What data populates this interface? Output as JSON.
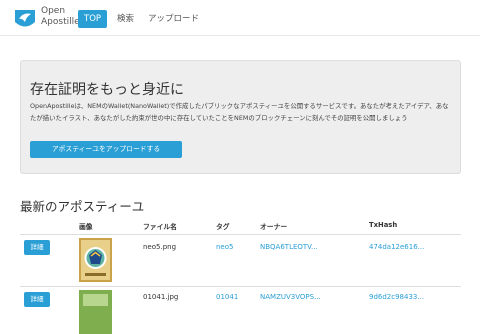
{
  "nav": {
    "brand_line1": "Open",
    "brand_line2": "Apostille",
    "items": [
      {
        "label": "TOP",
        "active": true
      },
      {
        "label": "検索",
        "active": false
      },
      {
        "label": "アップロード",
        "active": false
      }
    ]
  },
  "jumbotron": {
    "title": "存在証明をもっと身近に",
    "text": "OpenApostilleは、NEMのWallet(NanoWallet)で作成したパブリックなアポスティーユを公開するサービスです。あなたが考えたアイデア、あなたが描いたイラスト、あなたがした約束が世の中に存在していたことをNEMのブロックチェーンに刻んでその証明を公開しましょう",
    "upload_label": "アポスティーユをアップロードする"
  },
  "latest": {
    "title": "最新のアポスティーユ",
    "headers": [
      "画像",
      "ファイル名",
      "タグ",
      "オーナー",
      "TxHash"
    ],
    "rows": [
      {
        "button": "詳細",
        "filename": "neo5.png",
        "tag": "neo5",
        "owner": "NBQA6TLEOTV...",
        "txhash": "474da12e616..."
      },
      {
        "button": "詳細",
        "filename": "01041.jpg",
        "tag": "01041",
        "owner": "NAMZUV3VOPS...",
        "txhash": "9d6d2c98433..."
      }
    ]
  },
  "colors": {
    "accent": "#2a9fd6",
    "jumbotron_bg": "#eeeeee"
  }
}
